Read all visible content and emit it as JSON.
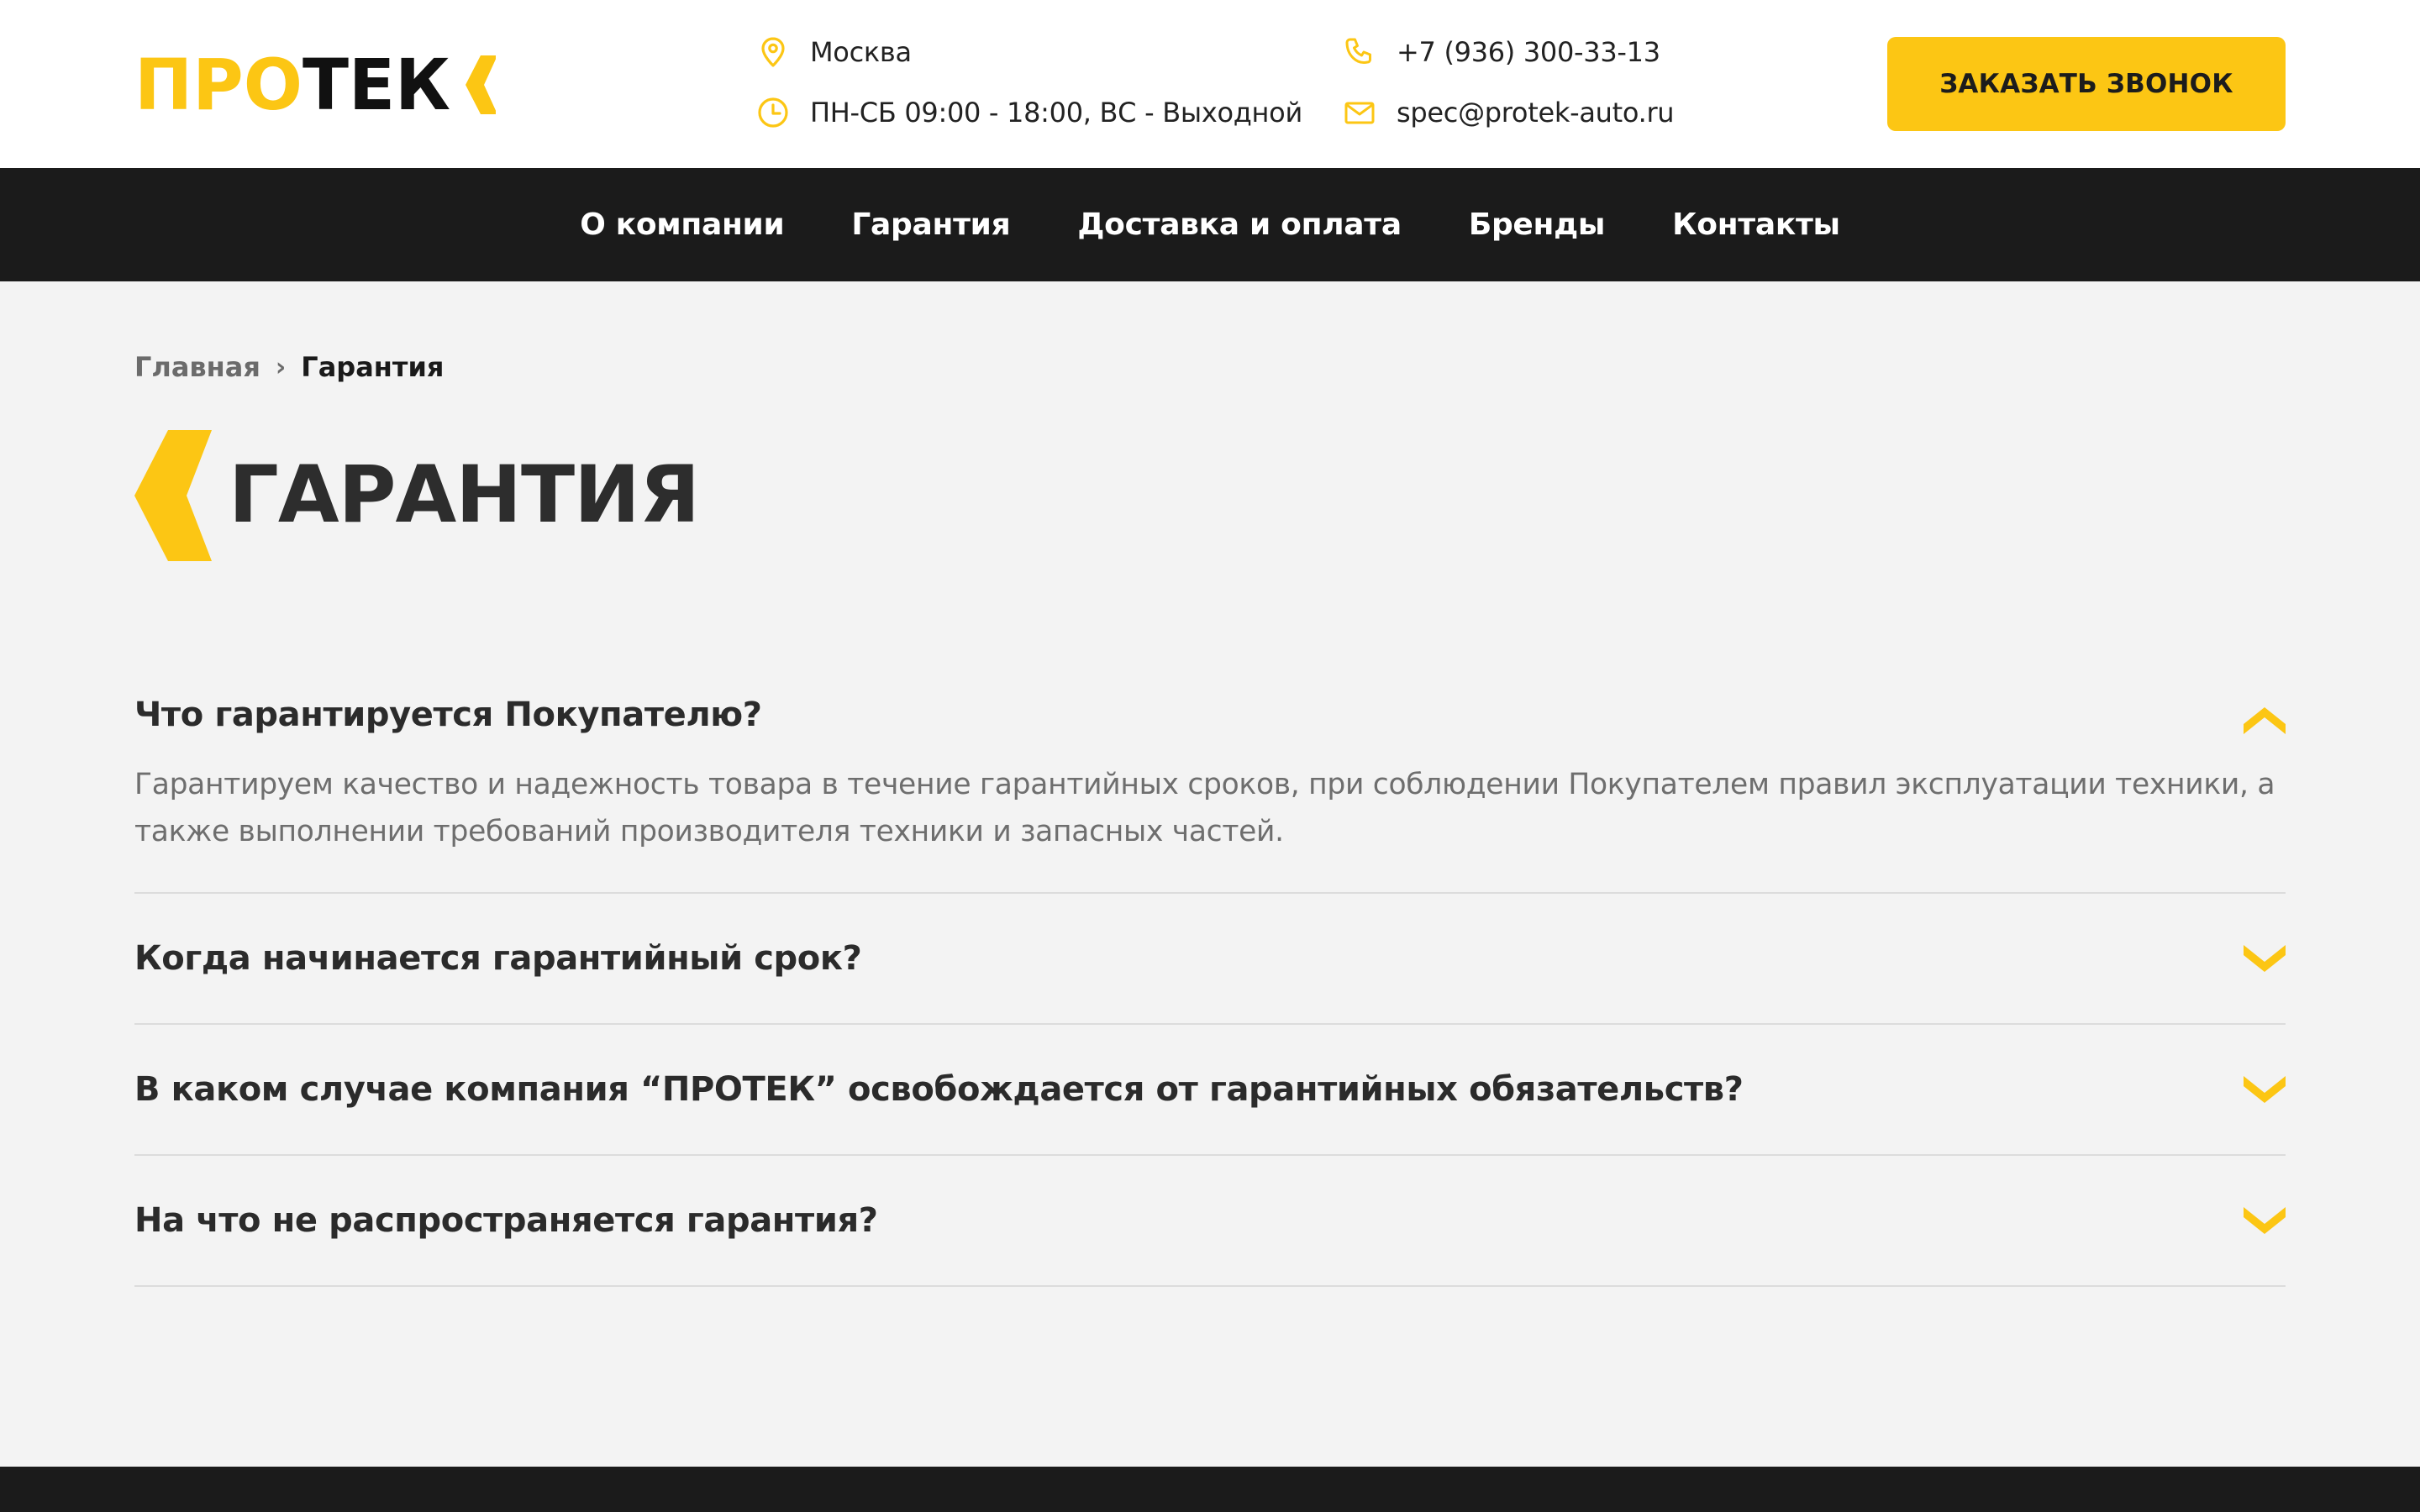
{
  "brand": {
    "logo_text_yellow": "ПРО",
    "logo_text_black": "ТЕК",
    "accent_color": "#fcc614",
    "dark_color": "#1b1b1b"
  },
  "header": {
    "city": "Москва",
    "hours": "ПН-СБ 09:00 - 18:00, ВС - Выходной",
    "phone": "+7 (936) 300-33-13",
    "email": "spec@protek-auto.ru",
    "call_button": "ЗАКАЗАТЬ ЗВОНОК",
    "icons": {
      "city": "map-pin-icon",
      "hours": "clock-icon",
      "phone": "phone-icon",
      "email": "mail-icon"
    }
  },
  "nav": {
    "items": [
      {
        "label": "О компании"
      },
      {
        "label": "Гарантия"
      },
      {
        "label": "Доставка и оплата"
      },
      {
        "label": "Бренды"
      },
      {
        "label": "Контакты"
      }
    ]
  },
  "breadcrumb": {
    "home": "Главная",
    "separator": "›",
    "current": "Гарантия"
  },
  "page": {
    "title": "ГАРАНТИЯ"
  },
  "faq": {
    "items": [
      {
        "question": "Что гарантируется Покупателю?",
        "answer": "Гарантируем качество и надежность товара в течение гарантийных сроков, при соблюдении Покупателем правил эксплуатации техники, а также выполнении требований производителя техники и запасных частей.",
        "expanded": true
      },
      {
        "question": "Когда начинается гарантийный срок?",
        "expanded": false
      },
      {
        "question": "В каком случае компания “ПРОТЕК” освобождается от гарантийных обязательств?",
        "expanded": false
      },
      {
        "question": "На что не распространяется гарантия?",
        "expanded": false
      }
    ]
  }
}
